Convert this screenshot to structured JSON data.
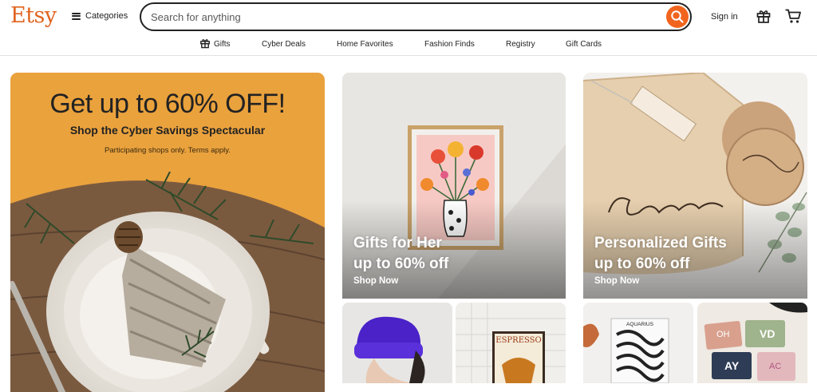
{
  "header": {
    "logo": "Etsy",
    "categories_label": "Categories",
    "search_placeholder": "Search for anything",
    "signin_label": "Sign in"
  },
  "nav": {
    "items": [
      "Gifts",
      "Cyber Deals",
      "Home Favorites",
      "Fashion Finds",
      "Registry",
      "Gift Cards"
    ]
  },
  "hero": {
    "title": "Get up to 60% OFF!",
    "subtitle": "Shop the Cyber Savings Spectacular",
    "note": "Participating shops only. Terms apply."
  },
  "tiles": [
    {
      "line1": "Gifts for Her",
      "line2": "up to 60% off",
      "cta": "Shop Now"
    },
    {
      "line1": "Personalized Gifts",
      "line2": "up to 60% off",
      "cta": "Shop Now"
    }
  ],
  "products": {
    "poster_text": "ESPRESSO",
    "book_text": "AQUARIUS",
    "wallet_initials": [
      "OH",
      "VD",
      "AY",
      "AC"
    ]
  },
  "colors": {
    "brand_orange": "#f1641e",
    "hero_bg": "#eaa23d"
  }
}
